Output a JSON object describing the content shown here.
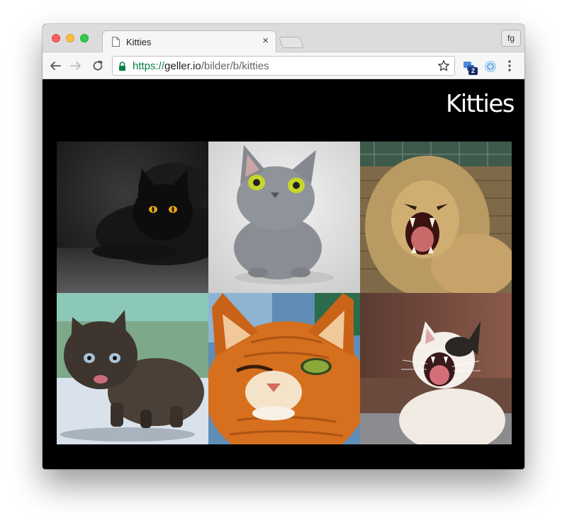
{
  "browser": {
    "tab": {
      "title": "Kitties",
      "close_glyph": "×",
      "icon": "document-icon"
    },
    "profile_label": "fg",
    "address": {
      "scheme": "https://",
      "host": "geller.io",
      "path": "/bilder/b/kitties"
    },
    "extension_badge": "2",
    "icons": [
      "back-arrow-icon",
      "forward-arrow-icon",
      "reload-icon",
      "lock-icon",
      "star-icon",
      "extension-icon",
      "menu-icon"
    ]
  },
  "page": {
    "title": "Kitties",
    "images": [
      {
        "subject": "black-cat"
      },
      {
        "subject": "gray-cat"
      },
      {
        "subject": "roaring-lion"
      },
      {
        "subject": "fluffy-kitten"
      },
      {
        "subject": "winking-ginger-cat"
      },
      {
        "subject": "yawning-white-cat"
      }
    ]
  },
  "colors": {
    "secure_url": "#0b8043",
    "page_background": "#000000",
    "title_text": "#ffffff"
  }
}
